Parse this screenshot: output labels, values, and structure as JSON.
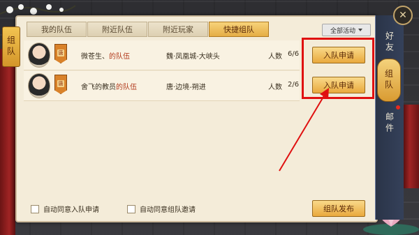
{
  "tabs": [
    {
      "label": "我的队伍"
    },
    {
      "label": "附近队伍"
    },
    {
      "label": "附近玩家"
    },
    {
      "label": "快捷组队",
      "active": true
    }
  ],
  "filter": {
    "label": "全部活动",
    "icon": "chevron-down-icon"
  },
  "left_tab": {
    "label": "组队"
  },
  "teams": [
    {
      "name": "微苍生、",
      "suffix": "的队伍",
      "badge": "唐",
      "location": "魏·凤凰城-大峡头",
      "count_label": "人数",
      "count": "6/6",
      "button": "入队申请"
    },
    {
      "name": "舍飞的教员",
      "suffix": "的队伍",
      "badge": "唐",
      "location": "唐·边境-朔进",
      "count_label": "人数",
      "count": "2/6",
      "button": "入队申请"
    }
  ],
  "footer": {
    "auto_accept_apply": "自动同意入队申请",
    "auto_accept_invite": "自动同意组队邀请",
    "publish_button": "组队发布"
  },
  "side_nav": [
    {
      "label": "好友"
    },
    {
      "label": "组队",
      "active": true
    },
    {
      "label": "邮件",
      "notify": true
    }
  ],
  "close_icon": "close-icon",
  "colors": {
    "accent_button": "#e9a93d",
    "highlight_red": "#e01010",
    "panel_bg": "#f4ecd9"
  }
}
